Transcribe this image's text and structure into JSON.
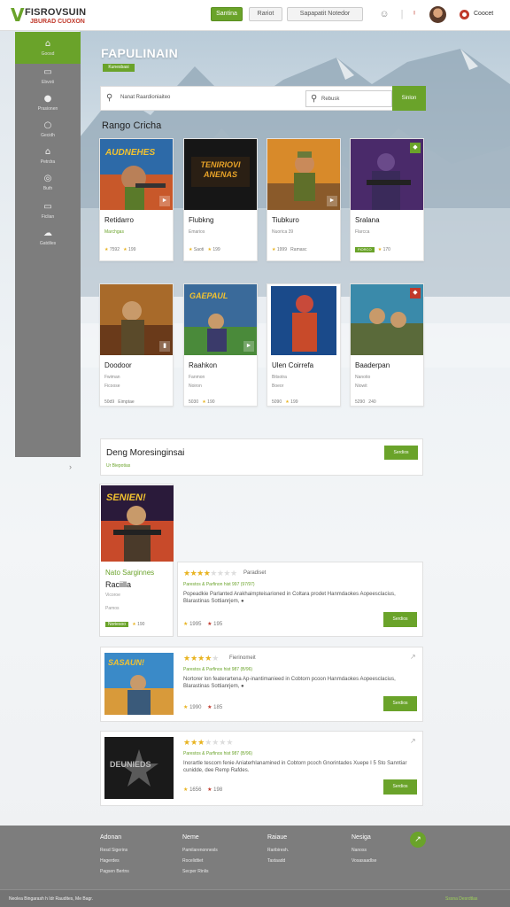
{
  "header": {
    "logo_title": "FISROVSUIN",
    "logo_tagline": "JBURAD CUOXON",
    "btn_primary": "Santina",
    "btn_secondary": "Rariot",
    "btn_tertiary": "Sapapatit Notedor",
    "user_name": "Coocet"
  },
  "sidebar": {
    "items": [
      {
        "label": "Goosd",
        "icon": "home-icon"
      },
      {
        "label": "Ebvoti",
        "icon": "inbox-icon"
      },
      {
        "label": "Prasionen",
        "icon": "apple-icon"
      },
      {
        "label": "Gecidh",
        "icon": "search-icon"
      },
      {
        "label": "Petrdra",
        "icon": "shield-icon"
      },
      {
        "label": "Buth",
        "icon": "mail-icon"
      },
      {
        "label": "Ficlian",
        "icon": "card-icon"
      },
      {
        "label": "Gatdiles",
        "icon": "cloud-icon"
      }
    ]
  },
  "hero": {
    "title": "FAPULINAIN",
    "badge": "Kunesbasi"
  },
  "search": {
    "placeholder": "Nanat Raardioniaiteo",
    "secondary_placeholder": "Rebusk",
    "button": "Sinlon"
  },
  "section_title": "Rango Cricha",
  "games_row1": [
    {
      "name": "Retidarro",
      "sub": "Marchgas",
      "rating": "7592",
      "count": "199",
      "art": "AUDNEHES"
    },
    {
      "name": "Flubkng",
      "sub": "Emarios",
      "rating": "Saoti",
      "count": "199",
      "art": "TENIRIOVI ANENAS"
    },
    {
      "name": "Tiubkuro",
      "sub": "Nuorica 39",
      "rating": "1999",
      "count": "Ramasc",
      "art": ""
    },
    {
      "name": "Sralana",
      "sub": "Flarcca",
      "rating": "FIORCO",
      "count": "170",
      "art": ""
    }
  ],
  "games_row2": [
    {
      "name": "Doodoor",
      "sub": "Fwiman",
      "rating": "Ficoose",
      "count": "Eimptae",
      "extra": "50d9",
      "art": ""
    },
    {
      "name": "Raahkon",
      "sub": "Fanmon",
      "rating": "Noiron",
      "count": "190",
      "extra": "5030",
      "art": "GAEPAUL"
    },
    {
      "name": "Ulen Coirrefa",
      "sub": "Bitsotra",
      "rating": "Boeor",
      "count": "199",
      "extra": "5090",
      "art": ""
    },
    {
      "name": "Baaderpan",
      "sub": "Nanotio",
      "rating": "Niowit",
      "count": "240",
      "extra": "5290",
      "art": ""
    }
  ],
  "promo": {
    "title": "Deng Moresinginsai",
    "subtitle": "Ur Biepotias",
    "button": "Serdios"
  },
  "featured": {
    "art": "SENIEN!",
    "name1": "Nato Sarginnes",
    "name2": "Raciilla",
    "sub": "Vicoroe",
    "sub2": "Pamos",
    "tag": "Noriesoo",
    "count": "190"
  },
  "list": [
    {
      "label": "Paradiset",
      "title": "Parestos & Parfinon hist 997 (97/97)",
      "desc": "Popeadkie Parlanted Arakhaimpteisarioned in Coltara prodet Hanmdaokes Aopeesclacius, Blarastinas Sottianrjem, ●",
      "r1": "1995",
      "r2": "195",
      "button": "Serdios",
      "art": "",
      "stars": 4
    },
    {
      "label": "Fierinomeit",
      "title": "Parestos & Parfinos hist 987 (B/96)",
      "desc": "Nortorer lon featerartena Ap-inantimanieed in Cobtorn pcoon Hanmdaokes Aopeesclacius, Blarastinas Sottianrjem, ●",
      "r1": "1990",
      "r2": "185",
      "button": "Serdios",
      "art": "SASAUN!",
      "stars": 4
    },
    {
      "label": "",
      "title": "Parestos & Parfinos hist 987 (B/96)",
      "desc": "Inorartle tescom fenie Aniaterhlanamined in Cobtorn pcoch Gnorintades Xuepe I 5 Sto Sanntiar cunidde, dee Remp Rafdes.",
      "r1": "1656",
      "r2": "198",
      "button": "Serdios",
      "art": "DEUNIEDS",
      "stars": 3
    }
  ],
  "footer": {
    "cols": [
      {
        "heading": "Adonan",
        "links": [
          "Resd Sigerins",
          "Hagerdes",
          "Pagsen Bertns"
        ]
      },
      {
        "heading": "Neme",
        "links": [
          "Pamilarenonnesls",
          "Rocelidtiet",
          "Secper Rinlis"
        ]
      },
      {
        "heading": "Raiaue",
        "links": [
          "Raribiresh.",
          "Tastaadd"
        ]
      },
      {
        "heading": "Nesiga",
        "links": [
          "Nanoss",
          "Vosasaadlse"
        ]
      }
    ],
    "copyright": "Neolea Bingarash h Idr Raudites, Me Bagr.",
    "link": "Sssna Desrdtlas"
  },
  "colors": {
    "accent": "#6aa32a",
    "sidebar": "#7d7d7d",
    "footer": "#7d7d7d",
    "star": "#e8b320"
  }
}
